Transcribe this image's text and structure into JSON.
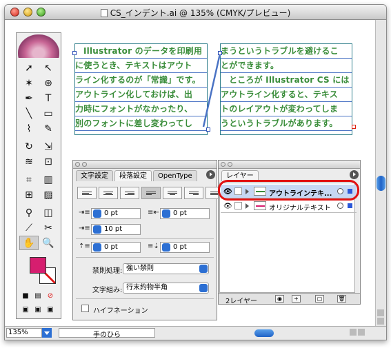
{
  "window": {
    "title": "CS_インデント.ai @ 135% (CMYK/プレビュー)"
  },
  "document": {
    "frame_left": {
      "lines": [
        "Illustrator のデータを印刷用",
        "に使うとき、テキストはアウト",
        "ライン化するのが「常識」です。",
        "アウトライン化しておけば、出",
        "力時にフォントがなかったり、",
        "別のフォントに差し変わってし"
      ]
    },
    "frame_right": {
      "lines": [
        "まうというトラブルを避けるこ",
        "とができます。",
        "ところが Illustrator CS には",
        "アウトライン化すると、テキス",
        "トのレイアウトが変わってしま",
        "うというトラブルがあります。"
      ]
    }
  },
  "paragraph_panel": {
    "tabs": [
      "文字設定",
      "段落設定",
      "OpenType"
    ],
    "active_tab": "段落設定",
    "left_indent": "0 pt",
    "right_indent": "0 pt",
    "first_line_indent": "10 pt",
    "space_before": "0 pt",
    "space_after": "0 pt",
    "kinsoku_label": "禁則処理:",
    "kinsoku_value": "強い禁則",
    "mojikumi_label": "文字組み:",
    "mojikumi_value": "行末約物半角",
    "hyphenation_label": "ハイフネーション"
  },
  "layers_panel": {
    "tab": "レイヤー",
    "layers": [
      {
        "name": "アウトラインテキ...",
        "selected": true,
        "color": "#2b58d8"
      },
      {
        "name": "オリジナルテキスト",
        "selected": false,
        "color": "#2b58d8"
      }
    ],
    "count_label": "2レイヤー"
  },
  "status": {
    "zoom": "135%",
    "tool": "手のひら"
  },
  "colors": {
    "fill": "#d61e6f",
    "text": "#3a8d3a",
    "highlight": "#e21212"
  }
}
